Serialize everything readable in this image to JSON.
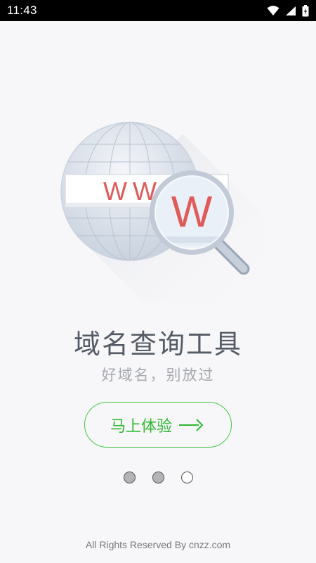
{
  "status_bar": {
    "time": "11:43",
    "icons": [
      "wifi-icon",
      "signal-icon",
      "battery-icon"
    ]
  },
  "illustration": {
    "url_text": "WWW",
    "magnified_letter": "W"
  },
  "title": "域名查询工具",
  "subtitle": "好域名，别放过",
  "start_button": {
    "label": "马上体验",
    "icon": "arrow-right-icon"
  },
  "pager": {
    "total": 3,
    "active_filled": [
      true,
      true,
      false
    ]
  },
  "footer": "All Rights Reserved By cnzz.com",
  "colors": {
    "accent_green": "#43c743",
    "title_gray": "#555b66",
    "subtitle_gray": "#a6a9ae",
    "url_red": "#e05a5a",
    "background": "#f7f7f9"
  }
}
